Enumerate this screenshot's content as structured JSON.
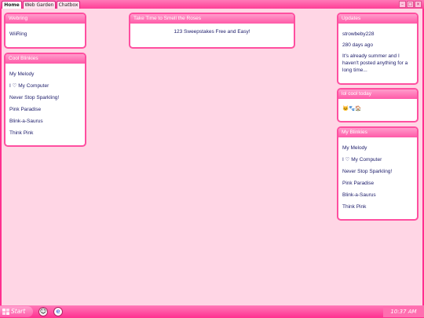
{
  "tabs": [
    {
      "label": "Home",
      "active": true
    },
    {
      "label": "Web Garden",
      "active": false
    },
    {
      "label": "Chatbox",
      "active": false
    }
  ],
  "webring": {
    "title": "Webring",
    "link": "WiiRing"
  },
  "cool_blinkies": {
    "title": "Cool Blinkies",
    "items": [
      "My Melody",
      "I ♡ My Computer",
      "Never Stop Sparkling!",
      "Pink Paradise",
      "Blink-a-Saurus",
      "Think Pink"
    ]
  },
  "roses": {
    "title": "Take Time to Smell the Roses",
    "text": "123 Sweepstakes Free and Easy!"
  },
  "updates": {
    "title": "Updates",
    "user": "strowbeby228",
    "time": "280 days ago",
    "text": "It's already summer and I haven't posted anything for a long time..."
  },
  "lol_cool": {
    "title": "lol cool today",
    "emojis": "🐱🐾🏠"
  },
  "my_blinkies": {
    "title": "My Blinkies",
    "items": [
      "My Melody",
      "I ♡ My Computer",
      "Never Stop Sparkling!",
      "Pink Paradise",
      "Blink-a-Saurus",
      "Think Pink"
    ]
  },
  "taskbar": {
    "start_label": "Start",
    "clock": "10:37 AM"
  },
  "colors": {
    "accent": "#ff4fa0",
    "desktop": "#ffd6e5",
    "link": "#1c1c6a"
  }
}
